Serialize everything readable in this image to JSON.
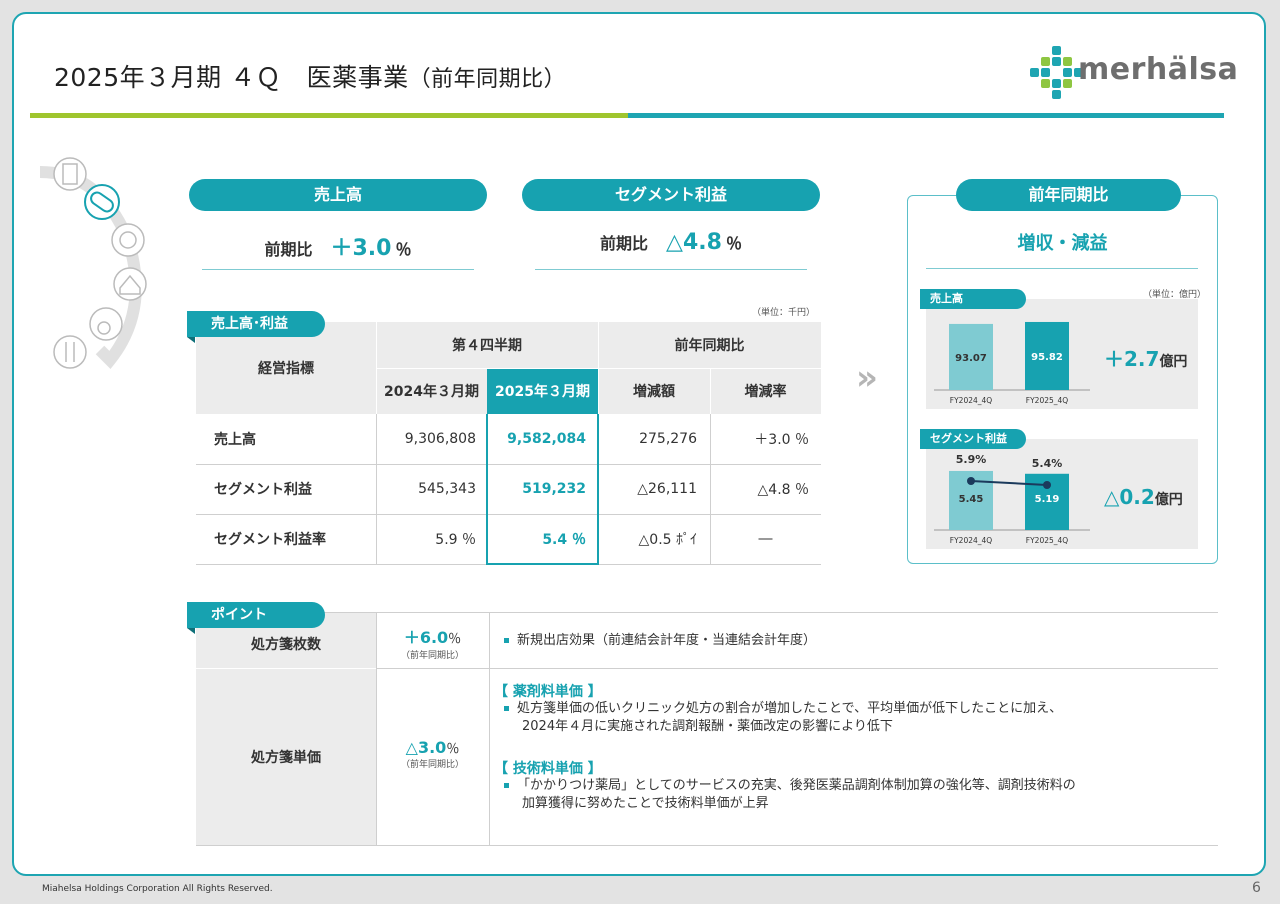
{
  "title": {
    "main": "2025年３月期 ４Ｑ　医薬事業",
    "paren": "（前年同期比）"
  },
  "logo": {
    "text": "merhälsa"
  },
  "kpis": [
    {
      "label": "売上高",
      "prefix": "前期比",
      "value": "＋3.0",
      "unit": "％"
    },
    {
      "label": "セグメント利益",
      "prefix": "前期比",
      "value": "△4.8",
      "unit": "％"
    }
  ],
  "table": {
    "tag": "売上高･利益",
    "unit": "（単位：千円）",
    "col_metric": "経営指標",
    "group_q4": "第４四半期",
    "group_yoy": "前年同期比",
    "col_2024": "2024年３月期",
    "col_2025": "2025年３月期",
    "col_diff": "増減額",
    "col_rate": "増減率",
    "rows": [
      {
        "label": "売上高",
        "v2024": "9,306,808",
        "v2025": "9,582,084",
        "diff": "275,276",
        "rate": "＋3.0 ％"
      },
      {
        "label": "セグメント利益",
        "v2024": "545,343",
        "v2025": "519,232",
        "diff": "△26,111",
        "rate": "△4.8 ％"
      },
      {
        "label": "セグメント利益率",
        "v2024": "5.9 ％",
        "v2025": "5.4 ％",
        "diff": "△0.5 ﾎﾟｲ",
        "rate": "―"
      }
    ]
  },
  "arrow": "»",
  "right_panel": {
    "pill": "前年同期比",
    "headline": "増収・減益",
    "unit": "（単位：億円）",
    "sales": {
      "tag": "売上高",
      "delta_value": "＋2.7",
      "delta_unit": "億円"
    },
    "profit": {
      "tag": "セグメント利益",
      "delta_value": "△0.2",
      "delta_unit": "億円"
    }
  },
  "chart_data": [
    {
      "type": "bar",
      "title": "売上高",
      "categories": [
        "FY2024_4Q",
        "FY2025_4Q"
      ],
      "values": [
        93.07,
        95.82
      ],
      "ylim": [
        0,
        100
      ]
    },
    {
      "type": "bar",
      "title": "セグメント利益",
      "categories": [
        "FY2024_4Q",
        "FY2025_4Q"
      ],
      "values": [
        5.45,
        5.19
      ],
      "line_series": {
        "values": [
          5.9,
          5.4
        ],
        "labels": [
          "5.9%",
          "5.4%"
        ]
      },
      "ylim": [
        0,
        6
      ]
    }
  ],
  "colors": {
    "teal": "#17a2b0",
    "light_teal": "#7fcbd2",
    "green": "#9fc52e"
  },
  "icons": [
    "building-icon",
    "pill-icon",
    "baby-icon",
    "house-icon",
    "wheelchair-icon",
    "cutlery-icon"
  ],
  "points": {
    "tag": "ポイント",
    "rows": [
      {
        "label": "処方箋枚数",
        "value": "＋6.0",
        "unit": "％",
        "sub": "（前年同期比）",
        "text": "新規出店効果（前連結会計年度・当連結会計年度）"
      },
      {
        "label": "処方箋単価",
        "value": "△3.0",
        "unit": "％",
        "sub": "（前年同期比）",
        "sect1": "【 薬剤料単価 】",
        "sect1_l1": "処方箋単価の低いクリニック処方の割合が増加したことで、平均単価が低下したことに加え、",
        "sect1_l2": "2024年４月に実施された調剤報酬・薬価改定の影響により低下",
        "sect2": "【 技術料単価 】",
        "sect2_l1": "「かかりつけ薬局」としてのサービスの充実、後発医薬品調剤体制加算の強化等、調剤技術料の",
        "sect2_l2": "加算獲得に努めたことで技術料単価が上昇"
      }
    ]
  },
  "footer": "Miahelsa Holdings Corporation All Rights Reserved.",
  "page_number": "6"
}
